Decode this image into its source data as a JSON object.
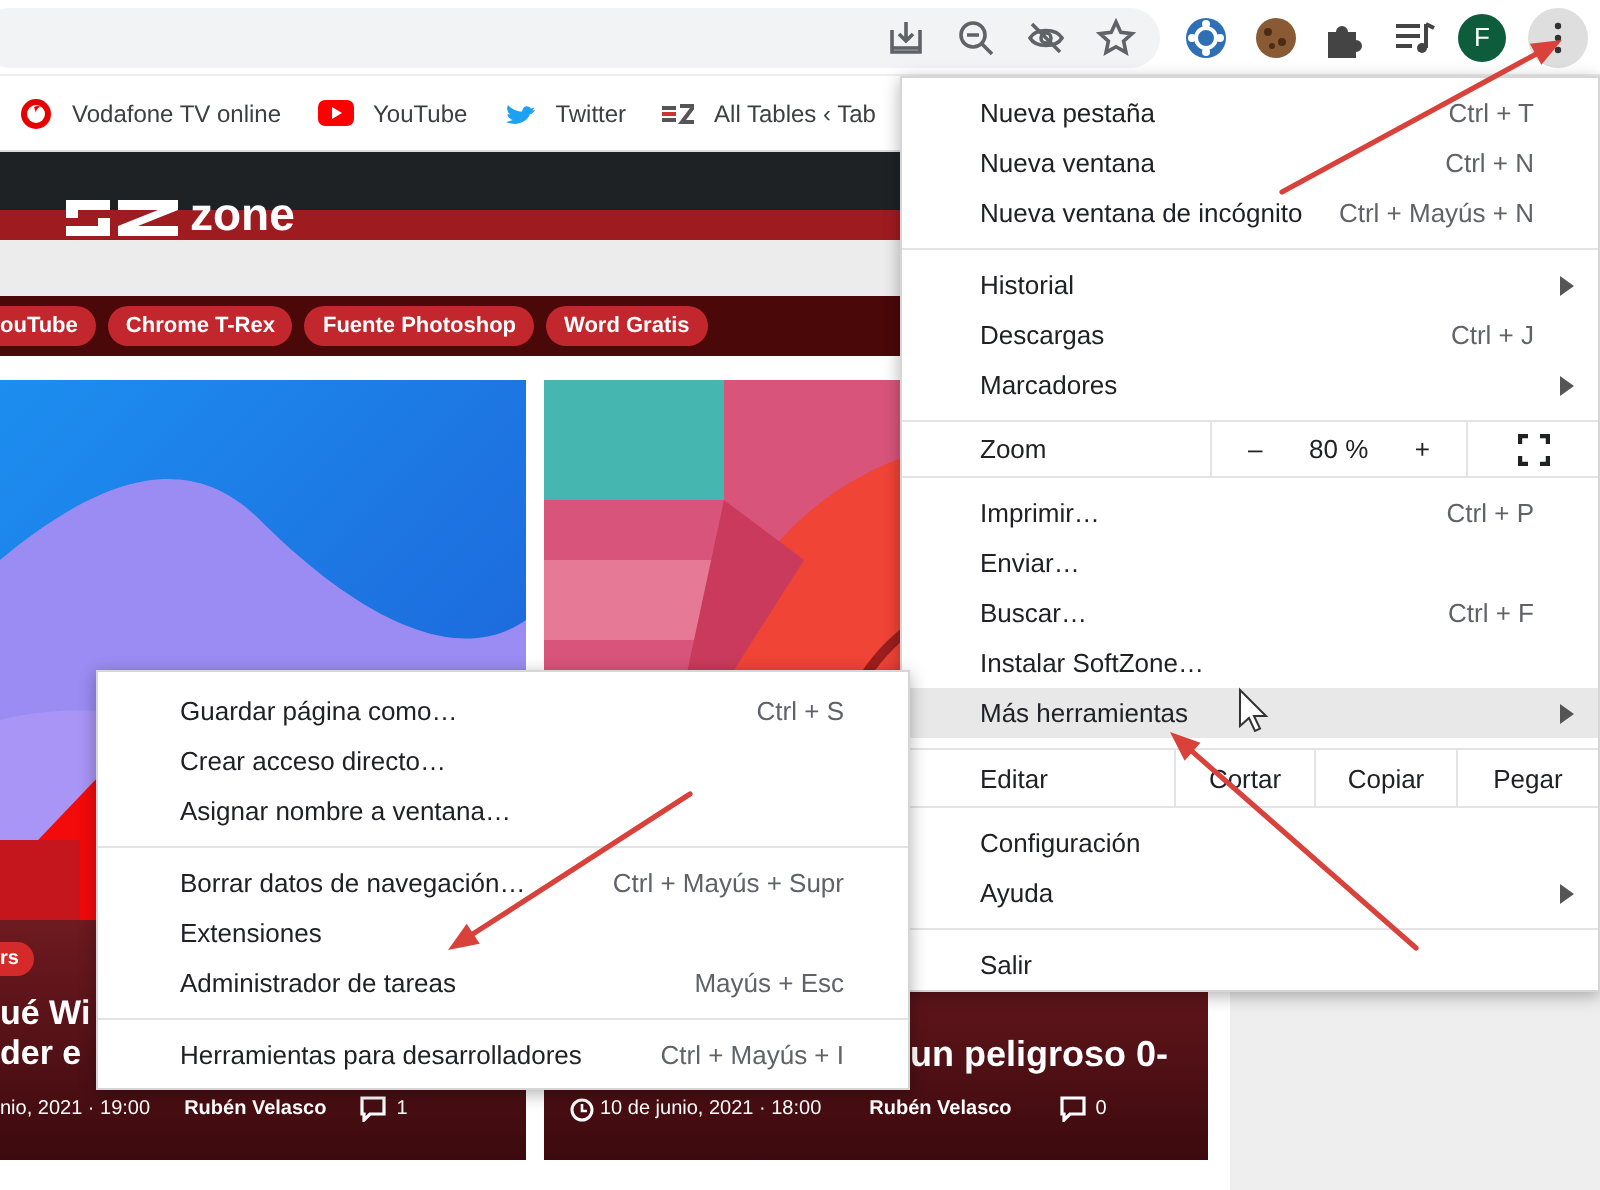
{
  "toolbar": {
    "avatar": "F"
  },
  "bookmarks": [
    {
      "label": "Vodafone TV online"
    },
    {
      "label": "YouTube"
    },
    {
      "label": "Twitter"
    },
    {
      "label": "All Tables ‹ Tab"
    }
  ],
  "site": {
    "logo": "zone",
    "tags": [
      "ouTube",
      "Chrome T-Rex",
      "Fuente Photoshop",
      "Word Gratis"
    ],
    "cards": [
      {
        "badge": "rs",
        "title_lines": [
          "ué Wi",
          "der e"
        ],
        "date": "nio, 2021 · 19:00",
        "author": "Rubén Velasco",
        "comments": "1"
      },
      {
        "title_lines": [
          "un peligroso 0-"
        ],
        "date": "10 de junio, 2021 · 18:00",
        "author": "Rubén Velasco",
        "comments": "0"
      }
    ]
  },
  "menu": {
    "groups": [
      {
        "kind": "items",
        "items": [
          {
            "label": "Nueva pestaña",
            "shortcut": "Ctrl + T",
            "submenu": false,
            "selected": false
          },
          {
            "label": "Nueva ventana",
            "shortcut": "Ctrl + N",
            "submenu": false,
            "selected": false
          },
          {
            "label": "Nueva ventana de incógnito",
            "shortcut": "Ctrl + Mayús + N",
            "submenu": false,
            "selected": false
          }
        ]
      },
      {
        "kind": "items",
        "items": [
          {
            "label": "Historial",
            "submenu": true,
            "selected": false
          },
          {
            "label": "Descargas",
            "shortcut": "Ctrl + J",
            "submenu": false,
            "selected": false
          },
          {
            "label": "Marcadores",
            "submenu": true,
            "selected": false
          }
        ]
      },
      {
        "kind": "zoom",
        "label": "Zoom",
        "minus": "–",
        "value": "80 %",
        "plus": "+"
      },
      {
        "kind": "items",
        "items": [
          {
            "label": "Imprimir…",
            "shortcut": "Ctrl + P",
            "submenu": false,
            "selected": false
          },
          {
            "label": "Enviar…",
            "submenu": false,
            "selected": false
          },
          {
            "label": "Buscar…",
            "shortcut": "Ctrl + F",
            "submenu": false,
            "selected": false
          },
          {
            "label": "Instalar SoftZone…",
            "submenu": false,
            "selected": false
          },
          {
            "label": "Más herramientas",
            "submenu": true,
            "selected": true
          }
        ]
      },
      {
        "kind": "edit",
        "label": "Editar",
        "actions": [
          "Cortar",
          "Copiar",
          "Pegar"
        ]
      },
      {
        "kind": "items",
        "items": [
          {
            "label": "Configuración",
            "submenu": false,
            "selected": false
          },
          {
            "label": "Ayuda",
            "submenu": true,
            "selected": false
          }
        ]
      },
      {
        "kind": "items",
        "items": [
          {
            "label": "Salir",
            "submenu": false,
            "selected": false
          }
        ]
      }
    ]
  },
  "submenu": {
    "groups": [
      {
        "kind": "items",
        "items": [
          {
            "label": "Guardar página como…",
            "shortcut": "Ctrl + S",
            "selected": false
          },
          {
            "label": "Crear acceso directo…",
            "selected": false
          },
          {
            "label": "Asignar nombre a ventana…",
            "selected": false
          }
        ]
      },
      {
        "kind": "items",
        "items": [
          {
            "label": "Borrar datos de navegación…",
            "shortcut": "Ctrl + Mayús + Supr",
            "selected": false
          },
          {
            "label": "Extensiones",
            "selected": false
          },
          {
            "label": "Administrador de tareas",
            "shortcut": "Mayús + Esc",
            "selected": false
          }
        ]
      },
      {
        "kind": "items",
        "items": [
          {
            "label": "Herramientas para desarrolladores",
            "shortcut": "Ctrl + Mayús + I",
            "selected": false
          }
        ]
      }
    ]
  }
}
